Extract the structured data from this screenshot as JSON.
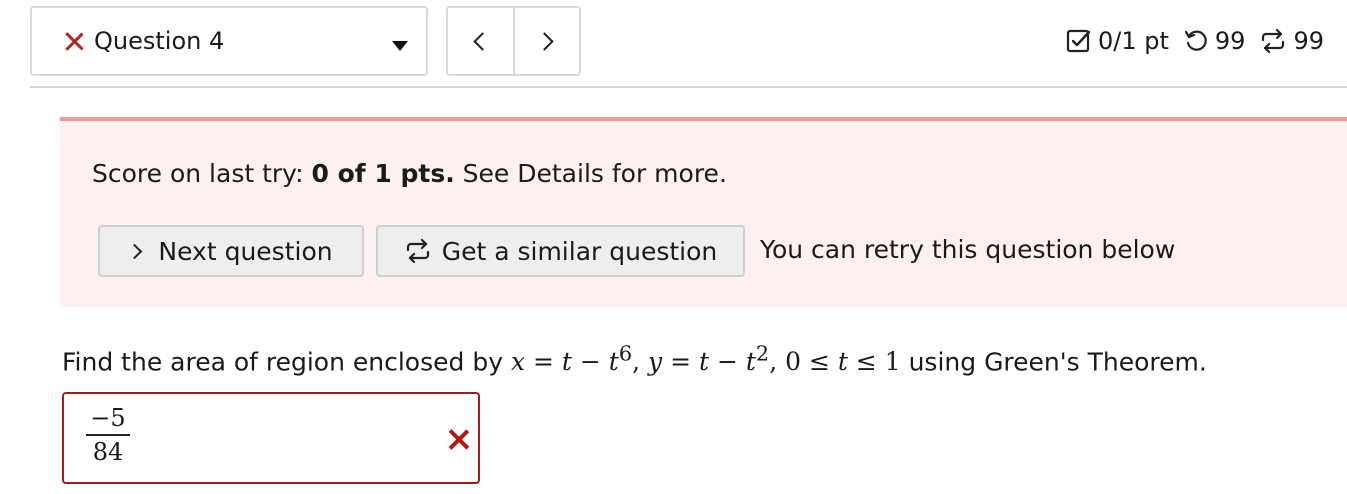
{
  "nav": {
    "question_label": "Question 4",
    "prev_label": "<",
    "next_label": ">"
  },
  "status": {
    "score": "0/1 pt",
    "retries_left": "99",
    "similar_left": "99"
  },
  "score_panel": {
    "prefix": "Score on last try: ",
    "score_bold": "0 of 1 pts.",
    "suffix": " See Details for more.",
    "next_question_label": "Next question",
    "similar_question_label": "Get a similar question",
    "retry_note": "You can retry this question below"
  },
  "question": {
    "prompt_before": "Find the area of region enclosed by ",
    "prompt_after": " using Green's Theorem.",
    "math": {
      "x_var": "x",
      "x_eq": " = ",
      "x_t": "t",
      "minus": " − ",
      "t": "t",
      "x_exp": "6",
      "sep1": ",  ",
      "y_var": "y",
      "y_eq": " = ",
      "y_exp": "2",
      "sep2": ",  ",
      "lower": "0",
      "le": " ≤ ",
      "upper": "1"
    }
  },
  "answer": {
    "numerator": "−5",
    "denominator": "84",
    "status": "incorrect"
  },
  "colors": {
    "error_red": "#b32424",
    "panel_bg": "#fdf0f0",
    "panel_border": "#f09a9a"
  },
  "icons": {
    "question_status": "incorrect-x-icon",
    "dropdown": "caret-down-icon",
    "score": "checkbox-icon",
    "retries": "retry-icon",
    "similar": "repeat-icon"
  }
}
